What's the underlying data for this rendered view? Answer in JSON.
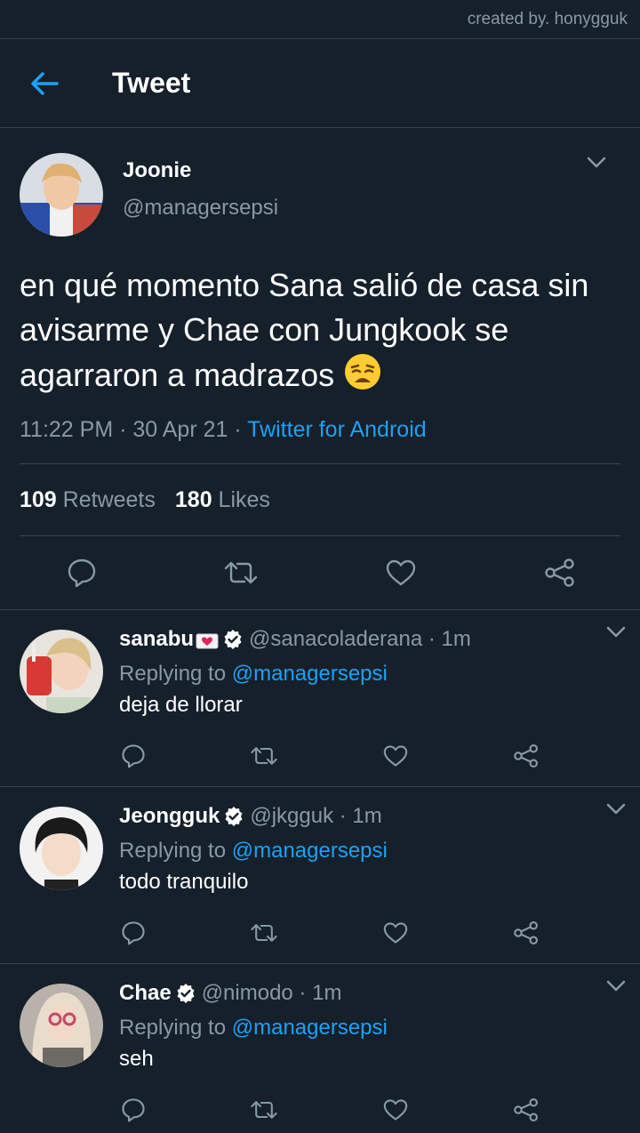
{
  "credit": "created by. honygguk",
  "header": {
    "title": "Tweet"
  },
  "tweet": {
    "name": "Joonie",
    "handle": "@managersepsi",
    "text": "en qué momento Sana salió de casa sin avisarme y Chae con Jungkook se agarraron a madrazos",
    "emoji": "weary-face-emoji",
    "time": "11:22 PM · 30 Apr 21 · ",
    "source": "Twitter for Android",
    "retweets_count": "109",
    "retweets_label": " Retweets",
    "likes_count": "180",
    "likes_label": " Likes"
  },
  "icons": [
    "back-arrow-icon",
    "chevron-down-icon",
    "reply-icon",
    "retweet-icon",
    "like-icon",
    "share-icon",
    "verified-icon"
  ],
  "replies": [
    {
      "name": "sanabu",
      "handle": "@sanacoladerana · 1m",
      "replying_prefix": "Replying to ",
      "replying_to": "@managersepsi",
      "text": "deja de llorar"
    },
    {
      "name": "Jeongguk",
      "handle": "@jkgguk · 1m",
      "replying_prefix": "Replying to ",
      "replying_to": "@managersepsi",
      "text": "todo tranquilo"
    },
    {
      "name": "Chae",
      "handle": "@nimodo · 1m",
      "replying_prefix": "Replying to ",
      "replying_to": "@managersepsi",
      "text": "seh"
    }
  ],
  "colors": {
    "background": "#15202b",
    "accent": "#1da1f2",
    "muted": "#8899a6",
    "divider": "#38444d"
  }
}
